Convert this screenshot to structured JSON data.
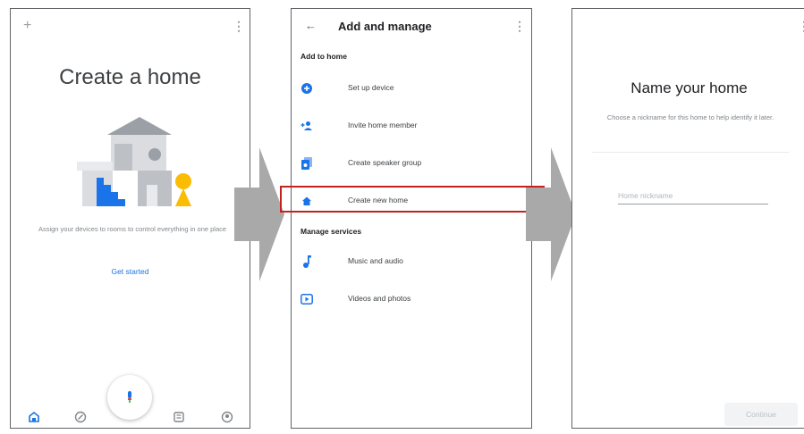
{
  "screen1": {
    "title": "Create a home",
    "description": "Assign your devices to rooms to control everything in one place",
    "get_started": "Get started",
    "nav": [
      "home-icon",
      "discover-icon",
      "feed-icon",
      "account-icon"
    ]
  },
  "screen2": {
    "back_icon": "←",
    "title": "Add and manage",
    "section_add": "Add to home",
    "add_items": [
      {
        "label": "Set up device",
        "icon": "plus-circle-icon"
      },
      {
        "label": "Invite home member",
        "icon": "person-add-icon"
      },
      {
        "label": "Create speaker group",
        "icon": "speaker-group-icon"
      },
      {
        "label": "Create new home",
        "icon": "home-icon"
      }
    ],
    "section_manage": "Manage services",
    "manage_items": [
      {
        "label": "Music and audio",
        "icon": "music-note-icon"
      },
      {
        "label": "Videos and photos",
        "icon": "video-icon"
      }
    ]
  },
  "screen3": {
    "title": "Name your home",
    "description": "Choose a nickname for this home to help identify it later.",
    "input_placeholder": "Home nickname",
    "input_value": "",
    "continue_label": "Continue"
  },
  "colors": {
    "accent_blue": "#1a73e8",
    "highlight_red": "#c5221f",
    "arrow_gray": "#a9a9a9",
    "yellow": "#fbbc04"
  }
}
